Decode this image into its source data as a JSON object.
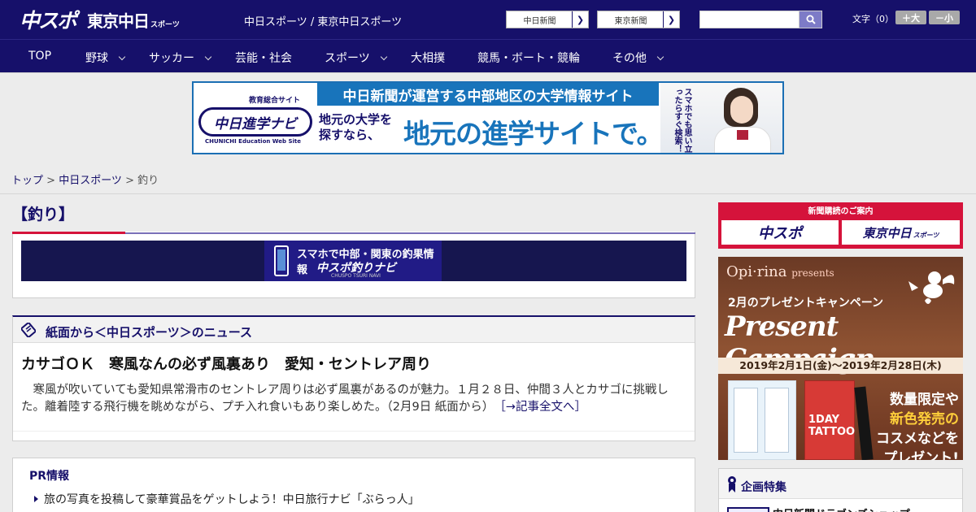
{
  "header": {
    "logo_main": "中スポ",
    "logo_tokyo": "東京中日",
    "logo_sports": "スポーツ",
    "site_links": "中日スポーツ / 東京中日スポーツ",
    "newspaper_buttons": [
      "中日新聞",
      "東京新聞"
    ],
    "search_placeholder": "",
    "font_size_label": "文字（0）",
    "font_bigger": "＋大",
    "font_smaller": "－小"
  },
  "nav": {
    "items": [
      {
        "label": "TOP",
        "has_dropdown": false
      },
      {
        "label": "野球",
        "has_dropdown": true
      },
      {
        "label": "サッカー",
        "has_dropdown": true
      },
      {
        "label": "芸能・社会",
        "has_dropdown": false
      },
      {
        "label": "スポーツ",
        "has_dropdown": true
      },
      {
        "label": "大相撲",
        "has_dropdown": false
      },
      {
        "label": "競馬・ボート・競輪",
        "has_dropdown": false
      },
      {
        "label": "その他",
        "has_dropdown": true
      }
    ]
  },
  "top_banner": {
    "badge": "教育総合サイト",
    "logo_text": "中日進学ナビ",
    "logo_en": "CHUNICHI Education Web Site",
    "headline": "中日新聞が運営する中部地区の大学情報サイト",
    "lead": "地元の大学を\n探すなら、",
    "big": "地元の進学サイトで。",
    "vertical": "スマホでも思い立ったらすぐ検索！"
  },
  "breadcrumb": {
    "top": "トップ",
    "sep1": " > ",
    "section": "中日スポーツ",
    "sep2": " > ",
    "current": "釣り"
  },
  "category": {
    "title": "【釣り】",
    "banner_line1": "スマホで中部・関東の釣果情報",
    "banner_line2": "中スポ釣りナビ",
    "banner_line3": "CHUSPO TSURI NAVI"
  },
  "news": {
    "heading": "紙面から＜中日スポーツ＞のニュース",
    "article_title": "カサゴＯＫ　寒風なんの必ず風裏あり　愛知・セントレア周り",
    "article_body": "寒風が吹いていても愛知県常滑市のセントレア周りは必ず風裏があるのが魅力。１月２８日、仲間３人とカサゴに挑戦した。離着陸する飛行機を眺めながら、プチ入れ食いもあり楽しめた。（2月9日 紙面から）",
    "more_link": "［→記事全文へ］"
  },
  "pr": {
    "title": "PR情報",
    "items": [
      "旅の写真を投稿して豪華賞品をゲットしよう！中日旅行ナビ「ぶらっ人」"
    ]
  },
  "sidebar": {
    "subscribe_heading": "新聞購読のご案内",
    "subscribe_buttons": [
      "中スポ",
      "東京中日"
    ],
    "subscribe_suffix": "スポーツ",
    "ad": {
      "brand": "Opi·rina",
      "brand_suffix": "presents",
      "subtitle": "2月のプレゼントキャンペーン",
      "campaign": "Present Campaign",
      "dates": "2019年2月1日(金)～2019年2月28日(木)",
      "product_label": "1DAY TATTOO",
      "copy_lines": [
        "数量限定や",
        "新色発売の",
        "コスメなどを",
        "プレゼント!"
      ]
    },
    "kikaku_title": "企画特集",
    "kikaku_item": "中日新聞ドラゴンズショップ"
  },
  "colors": {
    "navy": "#16106a",
    "accent_red": "#d5133b",
    "banner_blue": "#1874bb"
  }
}
